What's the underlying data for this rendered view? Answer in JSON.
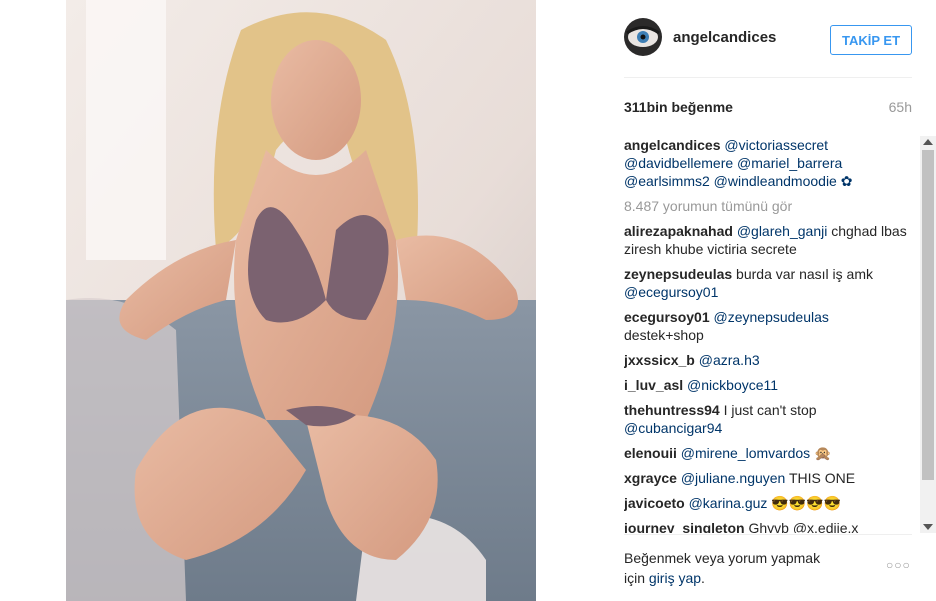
{
  "post": {
    "username": "angelcandices",
    "follow_label": "TAKİP ET",
    "likes": "311bin beğenme",
    "age": "65h"
  },
  "caption": {
    "username": "angelcandices",
    "text": "@victoriassecret @davidbellemere @mariel_barrera @earlsimms2 @windleandmoodie ✿"
  },
  "load_more": "8.487 yorumun tümünü gör",
  "comments": [
    {
      "user": "alirezapaknahad",
      "mention": "@glareh_ganji",
      "text": " chghad lbas ziresh khube victiria secrete"
    },
    {
      "user": "zeynepsudeulas",
      "mention": "",
      "text": "burda var nasıl iş amk"
    },
    {
      "user": "",
      "mention": "@ecegursoy01",
      "text": ""
    },
    {
      "user": "ecegursoy01",
      "mention": "@zeynepsudeulas",
      "text": " destek+shop"
    },
    {
      "user": "jxxssicx_b",
      "mention": "@azra.h3",
      "text": ""
    },
    {
      "user": "i_luv_asl",
      "mention": "@nickboyce11",
      "text": ""
    },
    {
      "user": "thehuntress94",
      "mention": "",
      "text": "I just can't stop"
    },
    {
      "user": "",
      "mention": "@cubancigar94",
      "text": ""
    },
    {
      "user": "elenouii",
      "mention": "@mirene_lomvardos",
      "text": " 🙊"
    },
    {
      "user": "xgrayce",
      "mention": "@juliane.nguyen",
      "text": " THIS ONE"
    },
    {
      "user": "javicoeto",
      "mention": "@karina.guz",
      "text": " 😎😎😎😎"
    },
    {
      "user": "journey_singleton",
      "mention": "",
      "text": "Ghyvb @x.ediie.x"
    }
  ],
  "footer": {
    "prompt": "Beğenmek veya yorum yapmak için ",
    "login": "giriş yap",
    "suffix": "."
  },
  "more_label": "○○○",
  "colors": {
    "link": "#003569",
    "accent": "#3897f0",
    "muted": "#999999"
  },
  "icons": {
    "avatar": "profile-avatar",
    "more": "ellipsis-icon"
  }
}
